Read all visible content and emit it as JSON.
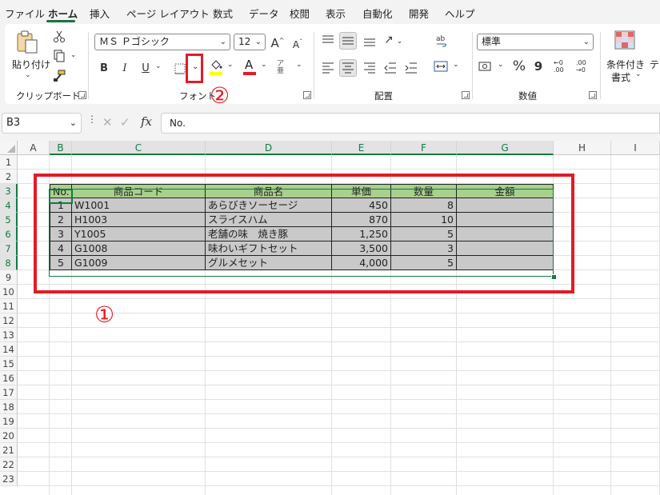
{
  "menu": {
    "items": [
      "ファイル",
      "ホーム",
      "挿入",
      "ページ レイアウト",
      "数式",
      "データ",
      "校閲",
      "表示",
      "自動化",
      "開発",
      "ヘルプ"
    ],
    "active": "ホーム"
  },
  "ribbon": {
    "clipboard": {
      "paste_label": "貼り付け",
      "group_label": "クリップボード"
    },
    "font": {
      "font_name": "ＭＳ Ｐゴシック",
      "font_size": "12",
      "grow": "A",
      "shrink": "A",
      "bold": "B",
      "italic": "I",
      "underline": "U",
      "font_color_letter": "A",
      "phonetic": "ア亜",
      "group_label": "フォント"
    },
    "alignment": {
      "group_label": "配置"
    },
    "number": {
      "format": "標準",
      "percent": "%",
      "comma": "9",
      "group_label": "数値"
    },
    "styles": {
      "cond_format_line1": "条件付き",
      "cond_format_line2": "書式",
      "table_partial": "テー"
    }
  },
  "formula_bar": {
    "name_box": "B3",
    "fx": "fx",
    "content": "No."
  },
  "sheet": {
    "columns": [
      "A",
      "B",
      "C",
      "D",
      "E",
      "F",
      "G",
      "H",
      "I"
    ],
    "rows": [
      "1",
      "2",
      "3",
      "4",
      "5",
      "6",
      "7",
      "8",
      "9",
      "10",
      "11",
      "12",
      "13",
      "14",
      "15",
      "16",
      "17",
      "18",
      "19",
      "20",
      "21",
      "22",
      "23"
    ],
    "selected_cell": "B3",
    "table": {
      "headers": [
        "No.",
        "商品コード",
        "商品名",
        "単価",
        "数量",
        "金額"
      ],
      "rows": [
        [
          "1",
          "W1001",
          "あらびきソーセージ",
          "450",
          "8",
          ""
        ],
        [
          "2",
          "H1003",
          "スライスハム",
          "870",
          "10",
          ""
        ],
        [
          "3",
          "Y1005",
          "老舗の味　焼き豚",
          "1,250",
          "5",
          ""
        ],
        [
          "4",
          "G1008",
          "味わいギフトセット",
          "3,500",
          "3",
          ""
        ],
        [
          "5",
          "G1009",
          "グルメセット",
          "4,000",
          "5",
          ""
        ]
      ],
      "header_color": "#a9d08e",
      "body_color": "#c9c9c9"
    }
  },
  "annotations": {
    "marker1": "①",
    "marker2": "②",
    "color": "#e21b25"
  }
}
